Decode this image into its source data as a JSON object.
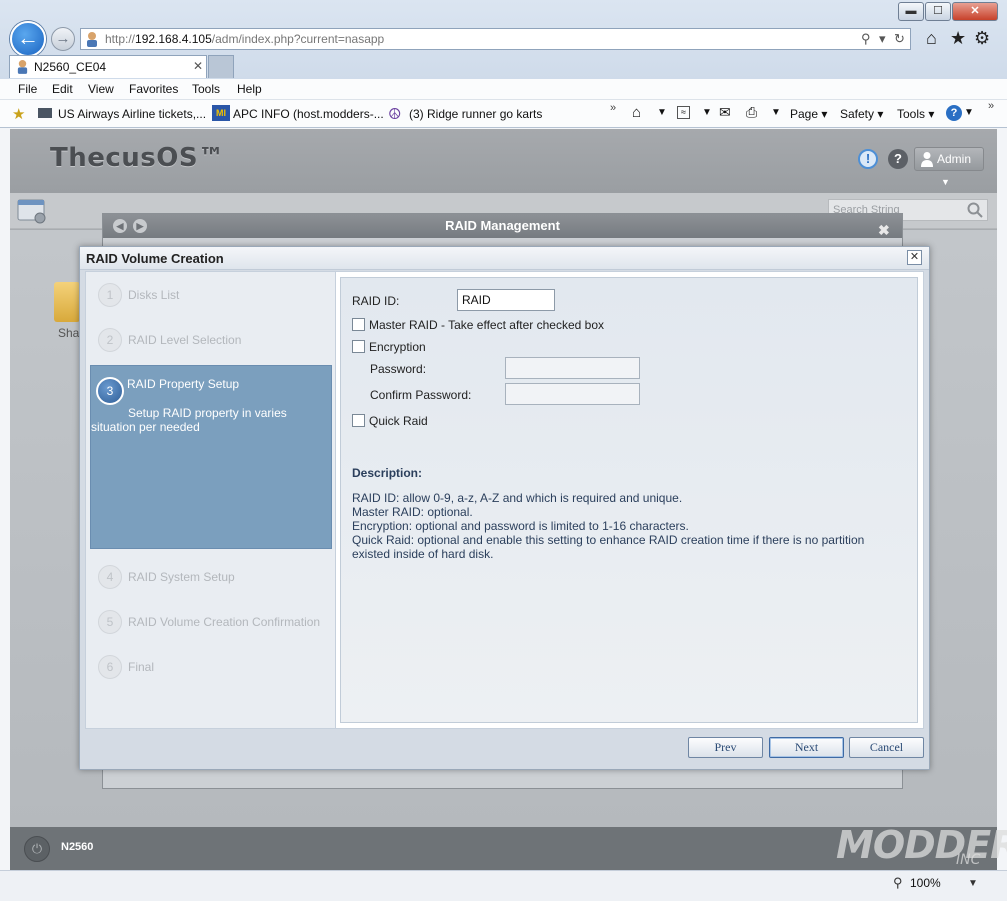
{
  "browser": {
    "window_buttons": {
      "minimize": "▬",
      "maximize": "☐",
      "close": "✕"
    },
    "address": {
      "prefix": "http://",
      "host": "192.168.4.105",
      "path": "/adm/index.php?current=nasapp"
    },
    "tab_title": "N2560_CE04",
    "menu": [
      "File",
      "Edit",
      "View",
      "Favorites",
      "Tools",
      "Help"
    ],
    "favorites": [
      "US Airways",
      "Airline tickets,...",
      "APC INFO (host.modders-...",
      "(3) Ridge runner go karts"
    ],
    "commands": [
      "Page ▾",
      "Safety ▾",
      "Tools ▾"
    ],
    "zoom": "100%"
  },
  "app": {
    "brand": "ThecusOS™",
    "user_label": "Admin",
    "search_placeholder": "Search String",
    "share_label": "Sha",
    "footer_device": "N2560",
    "raid_management_title": "RAID Management"
  },
  "dialog": {
    "title": "RAID Volume Creation",
    "steps": [
      {
        "number": "1",
        "label": "Disks List"
      },
      {
        "number": "2",
        "label": "RAID Level Selection"
      },
      {
        "number": "3",
        "label": "RAID Property Setup",
        "description": "Setup RAID property in varies situation per needed"
      },
      {
        "number": "4",
        "label": "RAID System Setup"
      },
      {
        "number": "5",
        "label": "RAID Volume Creation Confirmation"
      },
      {
        "number": "6",
        "label": "Final"
      }
    ],
    "form": {
      "raid_id_label": "RAID ID:",
      "raid_id_value": "RAID",
      "master_raid_label": "Master RAID - Take effect after checked box",
      "encryption_label": "Encryption",
      "password_label": "Password:",
      "confirm_password_label": "Confirm Password:",
      "quick_raid_label": "Quick Raid"
    },
    "description": {
      "heading": "Description:",
      "lines": [
        "RAID ID: allow 0-9, a-z, A-Z and which is required and unique.",
        "Master RAID: optional.",
        "Encryption: optional and password is limited to 1-16 characters.",
        "Quick Raid: optional and enable this setting to enhance RAID creation time if there is no partition",
        "existed inside of hard disk."
      ]
    },
    "buttons": {
      "prev": "Prev",
      "next": "Next",
      "cancel": "Cancel"
    }
  },
  "watermark": {
    "main": "MODDERS",
    "sub": "INC"
  }
}
